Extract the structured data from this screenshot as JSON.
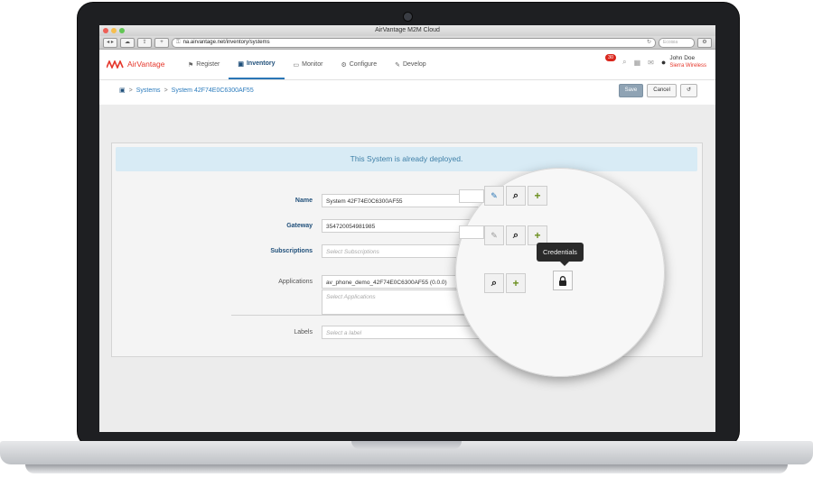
{
  "browser": {
    "window_title": "AirVantage M2M Cloud",
    "url": "na.airvantage.net/inventory/systems",
    "search_placeholder": "Ecoisia"
  },
  "app": {
    "brand": "AirVantage",
    "brand_color": "#e5362a",
    "nav": [
      {
        "label": "Register",
        "icon": "flag-icon"
      },
      {
        "label": "Inventory",
        "icon": "inventory-icon",
        "active": true
      },
      {
        "label": "Monitor",
        "icon": "monitor-icon"
      },
      {
        "label": "Configure",
        "icon": "gear-icon"
      },
      {
        "label": "Develop",
        "icon": "wrench-icon"
      }
    ],
    "notification_count": "30",
    "user": {
      "name": "John Doe",
      "org": "Sierra Wireless"
    }
  },
  "breadcrumb": {
    "items": [
      "Systems",
      "System 42F74E0C6300AF55"
    ]
  },
  "actions": {
    "save": "Save",
    "cancel": "Cancel"
  },
  "alert": {
    "text": "This System is already deployed."
  },
  "form": {
    "name": {
      "label": "Name",
      "value": "System 42F74E0C6300AF55"
    },
    "gateway": {
      "label": "Gateway",
      "value": "354720054981985"
    },
    "subscriptions": {
      "label": "Subscriptions",
      "placeholder": "Select Subscriptions"
    },
    "applications": {
      "label": "Applications",
      "value": "av_phone_demo_42F74E0C6300AF55 (0.0.0)",
      "placeholder": "Select Applications"
    },
    "labels": {
      "label": "Labels",
      "placeholder": "Select a label"
    }
  },
  "tooltip": {
    "text": "Credentials"
  },
  "colors": {
    "accent": "#2a76b6",
    "alert_bg": "#d8ebf5",
    "add_green": "#6b8f1e"
  }
}
